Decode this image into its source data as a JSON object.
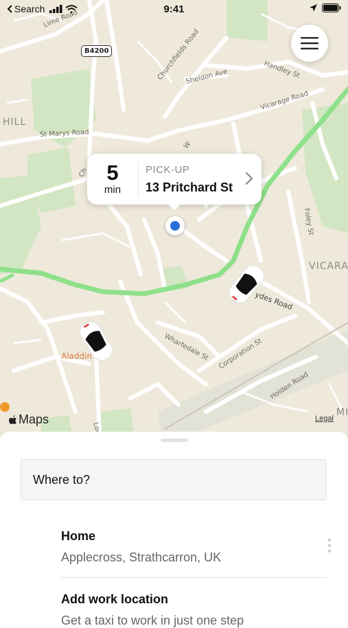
{
  "status_bar": {
    "back_label": "Search",
    "time": "9:41"
  },
  "map": {
    "area_labels": [
      "HILL",
      "VICARA",
      "MI"
    ],
    "road_shield": "B4200",
    "road_labels": [
      "Lime Road",
      "Churchfields Road",
      "Handley St",
      "Sheldon Ave",
      "Vicarage Road",
      "St Marys Road",
      "Foley St",
      "Wharfedale St",
      "Corporation St",
      "Holden Road",
      "ydes Road",
      "Lower",
      "Ch",
      "W"
    ],
    "poi_label": "Aladdin",
    "attribution": "Maps",
    "legal_link": "Legal"
  },
  "pickup": {
    "eta_value": "5",
    "eta_unit": "min",
    "label": "PICK-UP",
    "address": "13 Pritchard St"
  },
  "sheet": {
    "search_placeholder": "Where to?",
    "saved_places": [
      {
        "title": "Home",
        "subtitle": "Applecross, Strathcarron, UK"
      },
      {
        "title": "Add work location",
        "subtitle": "Get a taxi to work in just one step"
      }
    ]
  },
  "colors": {
    "route": "#8fe08a",
    "accent": "#2a6fd6",
    "map_bg": "#efe9dc",
    "park": "#cfe4be"
  }
}
